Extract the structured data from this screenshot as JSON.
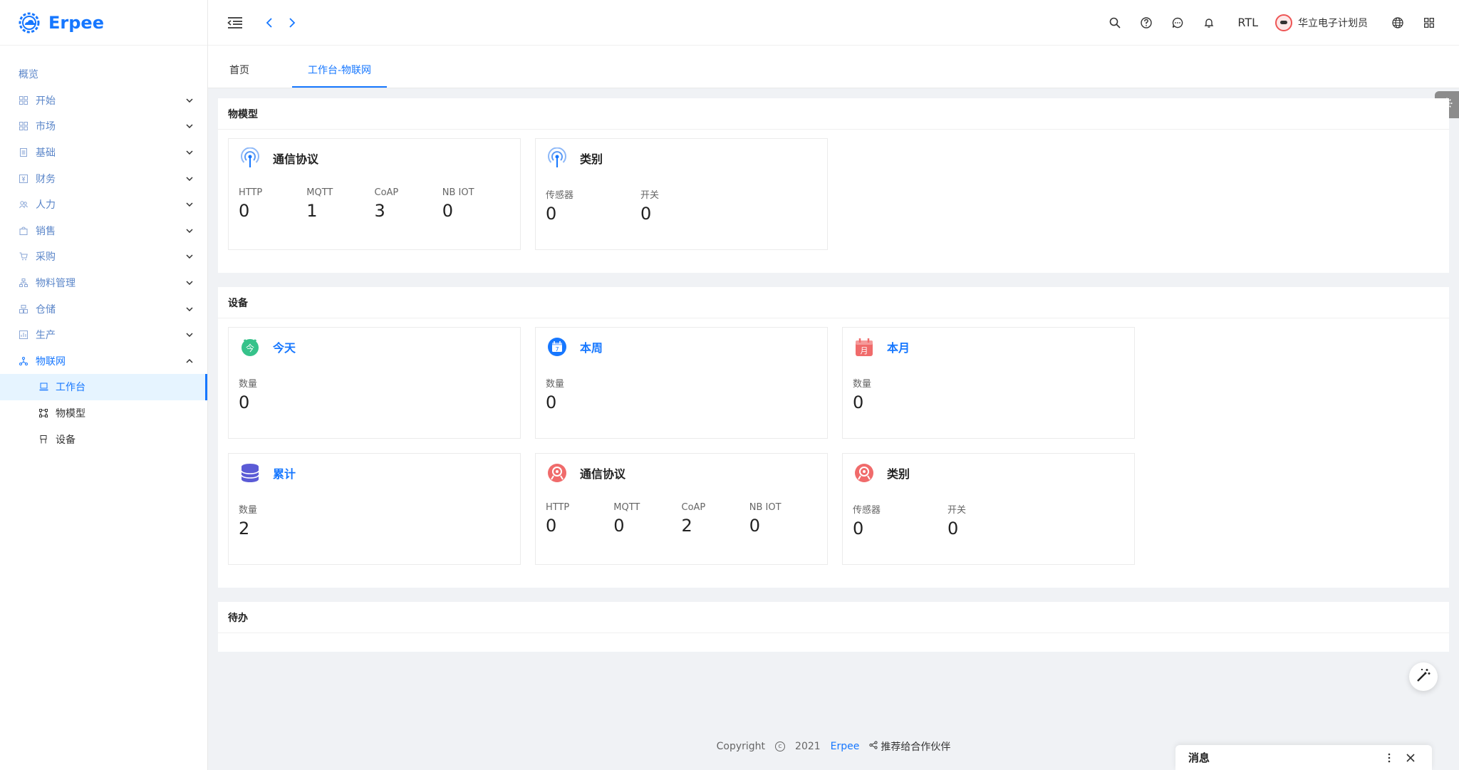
{
  "app": {
    "brand": "Erpee",
    "logo_icon": "gear-cloud-icon"
  },
  "sidebar": {
    "overview": "概览",
    "groups": [
      {
        "label": "开始",
        "icon": "grid-icon"
      },
      {
        "label": "市场",
        "icon": "grid-icon"
      },
      {
        "label": "基础",
        "icon": "document-icon"
      },
      {
        "label": "财务",
        "icon": "money-icon"
      },
      {
        "label": "人力",
        "icon": "users-icon"
      },
      {
        "label": "销售",
        "icon": "bag-icon"
      },
      {
        "label": "采购",
        "icon": "cart-icon"
      },
      {
        "label": "物料管理",
        "icon": "hierarchy-icon"
      },
      {
        "label": "仓储",
        "icon": "warehouse-icon"
      },
      {
        "label": "生产",
        "icon": "chart-icon"
      },
      {
        "label": "物联网",
        "icon": "network-icon"
      }
    ],
    "iot_sub": [
      {
        "label": "工作台",
        "icon": "laptop-icon"
      },
      {
        "label": "物模型",
        "icon": "frame-icon"
      },
      {
        "label": "设备",
        "icon": "device-icon"
      }
    ]
  },
  "header": {
    "rtl": "RTL",
    "user_name": "华立电子计划员"
  },
  "tabs": [
    {
      "label": "首页"
    },
    {
      "label": "工作台-物联网"
    }
  ],
  "sections": {
    "model": {
      "title": "物模型",
      "protocol": {
        "title": "通信协议",
        "labels": [
          "HTTP",
          "MQTT",
          "CoAP",
          "NB IOT"
        ],
        "values": [
          "0",
          "1",
          "3",
          "0"
        ]
      },
      "category": {
        "title": "类别",
        "labels": [
          "传感器",
          "开关"
        ],
        "values": [
          "0",
          "0"
        ]
      }
    },
    "device": {
      "title": "设备",
      "period_cards": [
        {
          "title": "今天",
          "label": "数量",
          "value": "0",
          "icon": "today-icon",
          "color": "#36c28a"
        },
        {
          "title": "本周",
          "label": "数量",
          "value": "0",
          "icon": "week-calendar-icon",
          "color": "#1677ff"
        },
        {
          "title": "本月",
          "label": "数量",
          "value": "0",
          "icon": "month-calendar-icon",
          "color": "#f06b6b"
        },
        {
          "title": "累计",
          "label": "数量",
          "value": "2",
          "icon": "database-icon",
          "color": "#5b5bd6"
        }
      ],
      "protocol": {
        "title": "通信协议",
        "labels": [
          "HTTP",
          "MQTT",
          "CoAP",
          "NB IOT"
        ],
        "values": [
          "0",
          "0",
          "2",
          "0"
        ]
      },
      "category": {
        "title": "类别",
        "labels": [
          "传感器",
          "开关"
        ],
        "values": [
          "0",
          "0"
        ]
      }
    },
    "todo": {
      "title": "待办"
    }
  },
  "footer": {
    "copyright": "Copyright",
    "year": "2021",
    "brand": "Erpee",
    "recommend": "推荐给合作伙伴"
  },
  "message_panel": {
    "title": "消息"
  }
}
